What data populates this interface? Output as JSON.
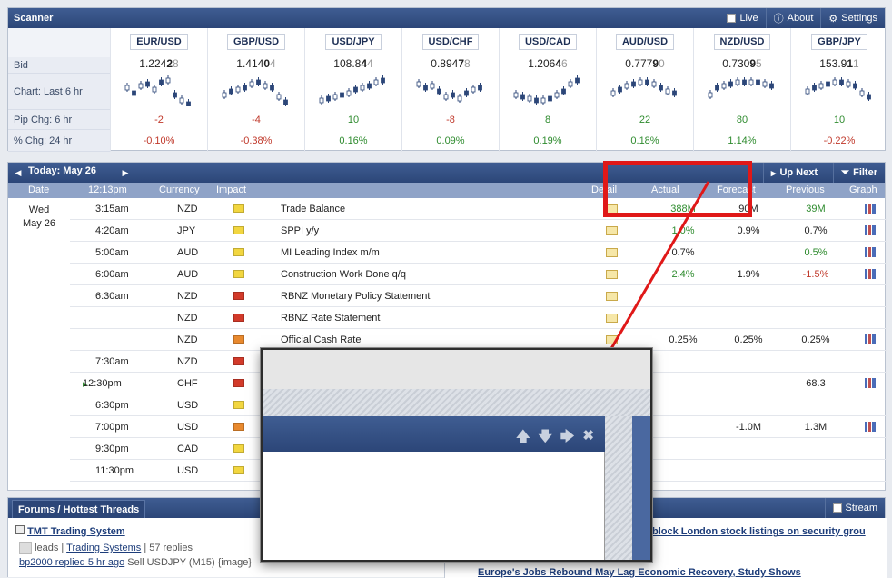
{
  "scanner": {
    "title": "Scanner",
    "live": "Live",
    "about": "About",
    "settings": "Settings",
    "row_labels": [
      "Bid",
      "Chart: Last 6 hr",
      "Pip Chg: 6 hr",
      "% Chg: 24 hr"
    ],
    "pairs": [
      {
        "name": "EUR/USD",
        "bid_main": "1.224",
        "bid_big": "2",
        "bid_small": "8",
        "pip": "-2",
        "pct": "-0.10%",
        "pos": false
      },
      {
        "name": "GBP/USD",
        "bid_main": "1.414",
        "bid_big": "0",
        "bid_small": "4",
        "pip": "-4",
        "pct": "-0.38%",
        "pos": false
      },
      {
        "name": "USD/JPY",
        "bid_main": "108.8",
        "bid_big": "4",
        "bid_small": "4",
        "pip": "10",
        "pct": "0.16%",
        "pos": true
      },
      {
        "name": "USD/CHF",
        "bid_main": "0.894",
        "bid_big": "7",
        "bid_small": "8",
        "pip": "-8",
        "pct": "0.09%",
        "pos": true
      },
      {
        "name": "USD/CAD",
        "bid_main": "1.206",
        "bid_big": "4",
        "bid_small": "6",
        "pip": "8",
        "pct": "0.19%",
        "pos": true
      },
      {
        "name": "AUD/USD",
        "bid_main": "0.777",
        "bid_big": "9",
        "bid_small": "0",
        "pip": "22",
        "pct": "0.18%",
        "pos": true
      },
      {
        "name": "NZD/USD",
        "bid_main": "0.730",
        "bid_big": "9",
        "bid_small": "5",
        "pip": "80",
        "pct": "1.14%",
        "pos": true
      },
      {
        "name": "GBP/JPY",
        "bid_main": "153.9",
        "bid_big": "1",
        "bid_small": "1",
        "pip": "10",
        "pct": "-0.22%",
        "pos": false
      }
    ]
  },
  "calendar": {
    "today": "Today: May 26",
    "up_next": "Up Next",
    "filter": "Filter",
    "headers": {
      "date": "Date",
      "time": "12:13pm",
      "currency": "Currency",
      "impact": "Impact",
      "detail": "Detail",
      "actual": "Actual",
      "forecast": "Forecast",
      "previous": "Previous",
      "graph": "Graph"
    },
    "day": "Wed",
    "date": "May 26",
    "rows": [
      {
        "time": "3:15am",
        "cur": "NZD",
        "imp": "#f2d640",
        "event": "Trade Balance",
        "detail": true,
        "actual": "388M",
        "actual_pos": true,
        "forecast": "90M",
        "previous": "39M",
        "prev_pos": true,
        "graph": true
      },
      {
        "time": "4:20am",
        "cur": "JPY",
        "imp": "#f2d640",
        "event": "SPPI y/y",
        "detail": true,
        "actual": "1.0%",
        "actual_pos": true,
        "forecast": "0.9%",
        "previous": "0.7%",
        "prev_pos": null,
        "graph": true
      },
      {
        "time": "5:00am",
        "cur": "AUD",
        "imp": "#f2d640",
        "event": "MI Leading Index m/m",
        "detail": true,
        "actual": "0.7%",
        "actual_pos": null,
        "forecast": "",
        "previous": "0.5%",
        "prev_pos": true,
        "graph": true
      },
      {
        "time": "6:00am",
        "cur": "AUD",
        "imp": "#f2d640",
        "event": "Construction Work Done q/q",
        "detail": true,
        "actual": "2.4%",
        "actual_pos": true,
        "forecast": "1.9%",
        "previous": "-1.5%",
        "prev_pos": false,
        "graph": true
      },
      {
        "time": "6:30am",
        "cur": "NZD",
        "imp": "#d23a2a",
        "event": "RBNZ Monetary Policy Statement",
        "detail": true,
        "actual": "",
        "actual_pos": null,
        "forecast": "",
        "previous": "",
        "prev_pos": null,
        "graph": false
      },
      {
        "time": "",
        "cur": "NZD",
        "imp": "#d23a2a",
        "event": "RBNZ Rate Statement",
        "detail": true,
        "actual": "",
        "actual_pos": null,
        "forecast": "",
        "previous": "",
        "prev_pos": null,
        "graph": false
      },
      {
        "time": "",
        "cur": "NZD",
        "imp": "#e8892e",
        "event": "Official Cash Rate",
        "detail": true,
        "actual": "0.25%",
        "actual_pos": null,
        "forecast": "0.25%",
        "previous": "0.25%",
        "prev_pos": null,
        "graph": true
      },
      {
        "time": "7:30am",
        "cur": "NZD",
        "imp": "#d23a2a",
        "event": "",
        "detail": false,
        "actual": "",
        "actual_pos": null,
        "forecast": "",
        "previous": "",
        "prev_pos": null,
        "graph": false
      },
      {
        "time": "12:30pm",
        "cur": "CHF",
        "imp": "#d23a2a",
        "event": "",
        "detail": false,
        "actual": "",
        "actual_pos": null,
        "forecast": "",
        "previous": "68.3",
        "prev_pos": null,
        "graph": true
      },
      {
        "time": "6:30pm",
        "cur": "USD",
        "imp": "#f2d640",
        "event": "",
        "detail": false,
        "actual": "",
        "actual_pos": null,
        "forecast": "",
        "previous": "",
        "prev_pos": null,
        "graph": false
      },
      {
        "time": "7:00pm",
        "cur": "USD",
        "imp": "#e8892e",
        "event": "",
        "detail": false,
        "actual": "",
        "actual_pos": null,
        "forecast": "-1.0M",
        "previous": "1.3M",
        "prev_pos": null,
        "graph": true
      },
      {
        "time": "9:30pm",
        "cur": "CAD",
        "imp": "#f2d640",
        "event": "",
        "detail": false,
        "actual": "",
        "actual_pos": null,
        "forecast": "",
        "previous": "",
        "prev_pos": null,
        "graph": false
      },
      {
        "time": "11:30pm",
        "cur": "USD",
        "imp": "#f2d640",
        "event": "",
        "detail": false,
        "actual": "",
        "actual_pos": null,
        "forecast": "",
        "previous": "",
        "prev_pos": null,
        "graph": false
      }
    ]
  },
  "forums": {
    "title": "Forums / Hottest Threads",
    "stream": "Stream",
    "thread_title": "TMT Trading System",
    "thread_author": "leads",
    "thread_forum": "Trading Systems",
    "thread_replies": "57 replies",
    "last_reply_user": "bp2000 replied 5 hr ago",
    "last_reply_text": "Sell USDJPY (M15) {image}"
  },
  "news": {
    "item1": "block London stock listings on security grou",
    "item2": "Europe's Jobs Rebound May Lag Economic Recovery, Study Shows"
  }
}
